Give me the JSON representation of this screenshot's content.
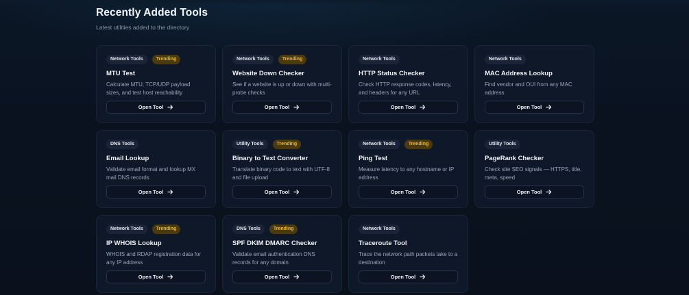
{
  "section": {
    "title": "Recently Added Tools",
    "subtitle": "Latest utilities added to the directory"
  },
  "open_label": "Open Tool",
  "colors": {
    "trending": "#f0b83a",
    "card_bg": "#0f1828",
    "page_bg": "#0a1220"
  },
  "tools": [
    {
      "category": "Network Tools",
      "trending": "Trending",
      "title": "MTU Test",
      "desc": "Calculate MTU, TCP/UDP payload sizes, and test host reachability",
      "button": "Open Tool"
    },
    {
      "category": "Network Tools",
      "trending": "Trending",
      "title": "Website Down Checker",
      "desc": "See if a website is up or down with multi-probe checks",
      "button": "Open Tool"
    },
    {
      "category": "Network Tools",
      "trending": null,
      "title": "HTTP Status Checker",
      "desc": "Check HTTP response codes, latency, and headers for any URL",
      "button": "Open Tool"
    },
    {
      "category": "Network Tools",
      "trending": null,
      "title": "MAC Address Lookup",
      "desc": "Find vendor and OUI from any MAC address",
      "button": "Open Tool"
    },
    {
      "category": "DNS Tools",
      "trending": null,
      "title": "Email Lookup",
      "desc": "Validate email format and lookup MX mail DNS records",
      "button": "Open Tool"
    },
    {
      "category": "Utility Tools",
      "trending": "Trending",
      "title": "Binary to Text Converter",
      "desc": "Translate binary code to text with UTF-8 and file upload",
      "button": "Open Tool"
    },
    {
      "category": "Network Tools",
      "trending": "Trending",
      "title": "Ping Test",
      "desc": "Measure latency to any hostname or IP address",
      "button": "Open Tool"
    },
    {
      "category": "Utility Tools",
      "trending": null,
      "title": "PageRank Checker",
      "desc": "Check site SEO signals — HTTPS, title, meta, speed",
      "button": "Open Tool"
    },
    {
      "category": "Network Tools",
      "trending": "Trending",
      "title": "IP WHOIS Lookup",
      "desc": "WHOIS and RDAP registration data for any IP address",
      "button": "Open Tool"
    },
    {
      "category": "DNS Tools",
      "trending": "Trending",
      "title": "SPF DKIM DMARC Checker",
      "desc": "Validate email authentication DNS records for any domain",
      "button": "Open Tool"
    },
    {
      "category": "Network Tools",
      "trending": null,
      "title": "Traceroute Tool",
      "desc": "Trace the network path packets take to a destination",
      "button": "Open Tool"
    }
  ]
}
